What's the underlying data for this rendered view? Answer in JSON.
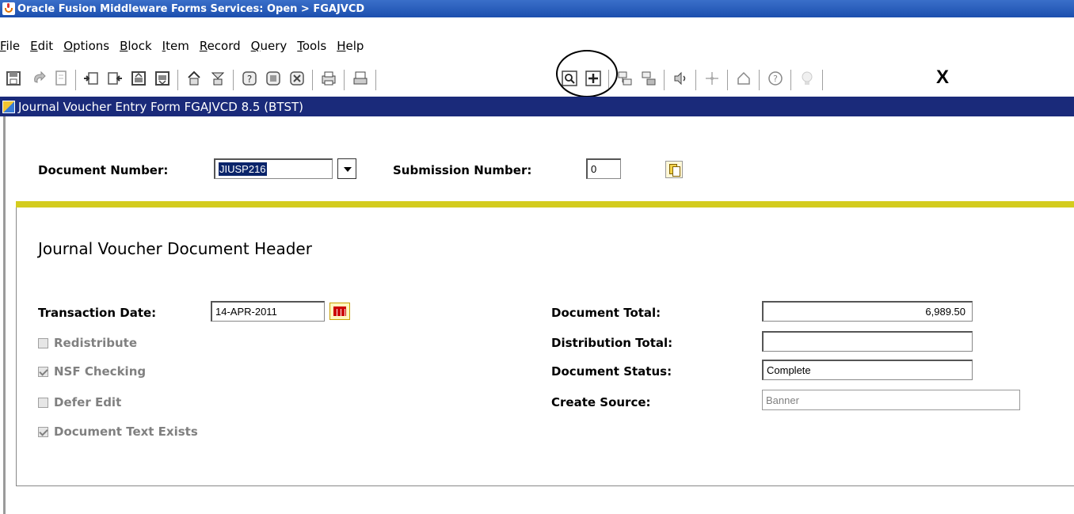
{
  "window": {
    "title": "Oracle Fusion Middleware Forms Services: Open > FGAJVCD"
  },
  "menu": {
    "items": [
      {
        "first": "F",
        "rest": "ile"
      },
      {
        "first": "E",
        "rest": "dit"
      },
      {
        "first": "O",
        "rest": "ptions"
      },
      {
        "first": "B",
        "rest": "lock"
      },
      {
        "first": "I",
        "rest": "tem"
      },
      {
        "first": "R",
        "rest": "ecord"
      },
      {
        "first": "Q",
        "rest": "uery"
      },
      {
        "first": "T",
        "rest": "ools"
      },
      {
        "first": "H",
        "rest": "elp"
      }
    ]
  },
  "toolbar": {
    "icons": [
      "save-icon",
      "rollback-icon",
      "print-preview-icon",
      "insert-record-icon",
      "remove-record-icon",
      "lock-record-icon",
      "duplicate-record-icon",
      "block-icon",
      "next-block-icon",
      "enter-query-icon",
      "execute-query-icon",
      "cancel-query-icon",
      "print-icon",
      "search-icon",
      "options-search-icon",
      "count-query-icon",
      "next-record-icon",
      "previous-record-icon",
      "help-icon",
      "lov-icon",
      "online-help-icon",
      "bulb-icon"
    ],
    "exit_label": "X"
  },
  "form": {
    "title": "Journal Voucher Entry Form  FGAJVCD  8.5  (BTST)"
  },
  "key_block": {
    "document_number_label": "Document Number:",
    "document_number_value": "JIUSP216",
    "submission_number_label": "Submission Number:",
    "submission_number_value": "0"
  },
  "header": {
    "heading": "Journal Voucher Document Header",
    "transaction_date_label": "Transaction Date:",
    "transaction_date_value": "14-APR-2011",
    "redistribute_label": "Redistribute",
    "redistribute_checked": false,
    "nsf_checking_label": "NSF Checking",
    "nsf_checking_checked": true,
    "defer_edit_label": "Defer Edit",
    "defer_edit_checked": false,
    "document_text_exists_label": "Document Text Exists",
    "document_text_exists_checked": true,
    "document_total_label": "Document Total:",
    "document_total_value": "6,989.50",
    "distribution_total_label": "Distribution Total:",
    "distribution_total_value": "",
    "document_status_label": "Document Status:",
    "document_status_value": "Complete",
    "create_source_label": "Create Source:",
    "create_source_value": "Banner"
  },
  "colors": {
    "titlebar": "#1c4fae",
    "form_titlebar": "#1a2a7a",
    "separator": "#d4cc1e"
  }
}
